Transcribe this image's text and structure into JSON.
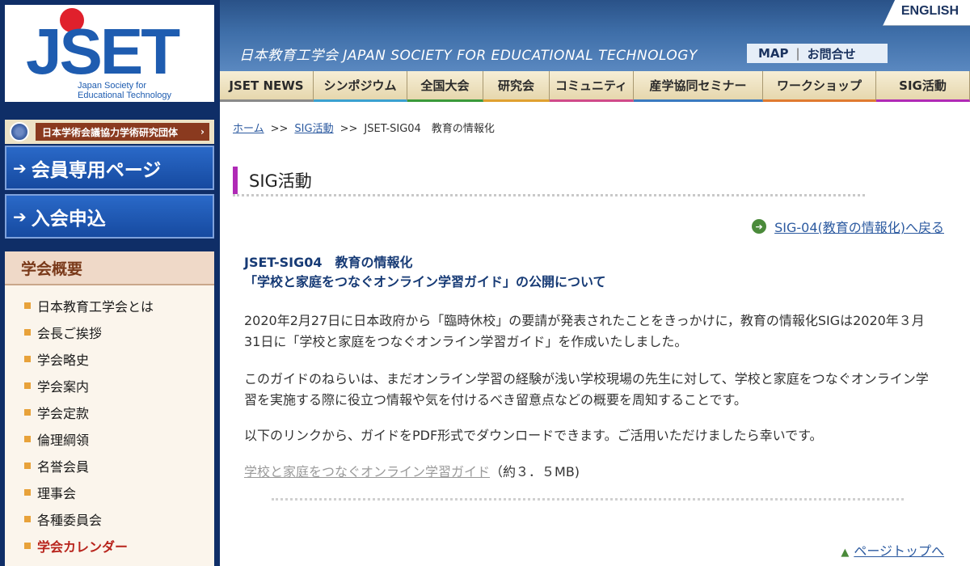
{
  "header": {
    "logo_text": "JSET",
    "logo_sub_line1": "Japan Society for",
    "logo_sub_line2": "Educational Technology",
    "english_label": "ENGLISH",
    "site_title": "日本教育工学会  JAPAN SOCIETY FOR EDUCATIONAL TECHNOLOGY",
    "util_map": "MAP",
    "util_sep": "|",
    "util_contact": "お問合せ"
  },
  "nav": {
    "items": [
      {
        "label": "JSET NEWS",
        "accent": "#8a8a8a"
      },
      {
        "label": "シンポジウム",
        "accent": "#3aa0d0"
      },
      {
        "label": "全国大会",
        "accent": "#3a9a3a"
      },
      {
        "label": "研究会",
        "accent": "#e0a030"
      },
      {
        "label": "コミュニティ",
        "accent": "#d04a8a"
      },
      {
        "label": "産学協同セミナー",
        "accent": "#3a7ac0"
      },
      {
        "label": "ワークショップ",
        "accent": "#e07a30"
      },
      {
        "label": "SIG活動",
        "accent": "#b02ab6"
      }
    ]
  },
  "sidebar": {
    "scj_label": "日本学術会議協力学術研究団体",
    "scj_chevron": "›",
    "member_button": "会員専用ページ",
    "join_button": "入会申込",
    "arrow": "➔",
    "section_heading": "学会概要",
    "items": [
      {
        "label": "日本教育工学会とは"
      },
      {
        "label": "会長ご挨拶"
      },
      {
        "label": "学会略史"
      },
      {
        "label": "学会案内"
      },
      {
        "label": "学会定款"
      },
      {
        "label": "倫理綱領"
      },
      {
        "label": "名誉会員"
      },
      {
        "label": "理事会"
      },
      {
        "label": "各種委員会"
      },
      {
        "label": "学会カレンダー"
      }
    ]
  },
  "breadcrumb": {
    "home": "ホーム",
    "sep": ">>",
    "sig": "SIG活動",
    "current": "JSET-SIG04　教育の情報化"
  },
  "main": {
    "page_title": "SIG活動",
    "back_link": "SIG-04(教育の情報化)へ戻る",
    "article_head_line1": "JSET-SIG04　教育の情報化",
    "article_head_line2": "「学校と家庭をつなぐオンライン学習ガイド」の公開について",
    "p1": "2020年2月27日に日本政府から「臨時休校」の要請が発表されたことをきっかけに，教育の情報化SIGは2020年３月31日に「学校と家庭をつなぐオンライン学習ガイド」を作成いたしました。",
    "p2": "このガイドのねらいは、まだオンライン学習の経験が浅い学校現場の先生に対して、学校と家庭をつなぐオンライン学習を実施する際に役立つ情報や気を付けるべき留意点などの概要を周知することです。",
    "p3": "以下のリンクから、ガイドをPDF形式でダウンロードできます。ご活用いただけましたら幸いです。",
    "guide_link": "学校と家庭をつなぐオンライン学習ガイド",
    "guide_size": "（約３．５MB)",
    "pagetop": "ページトップへ",
    "pagetop_tri": "▲"
  }
}
